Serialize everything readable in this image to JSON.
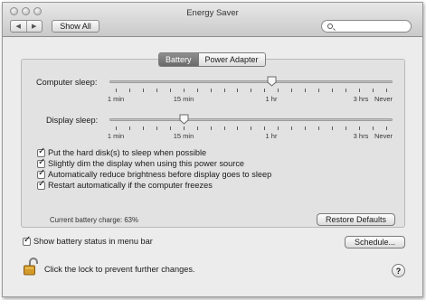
{
  "window": {
    "title": "Energy Saver"
  },
  "toolbar": {
    "back_glyph": "◀",
    "forward_glyph": "▶",
    "show_all_label": "Show All",
    "search_placeholder": ""
  },
  "tabs": [
    {
      "label": "Battery",
      "selected": true
    },
    {
      "label": "Power Adapter",
      "selected": false
    }
  ],
  "computer_sleep": {
    "label": "Computer sleep:",
    "selected": "1 hr",
    "tick_labels": [
      "1 min",
      "15 min",
      "1 hr",
      "3 hrs",
      "Never"
    ]
  },
  "display_sleep": {
    "label": "Display sleep:",
    "selected": "15 min",
    "tick_labels": [
      "1 min",
      "15 min",
      "1 hr",
      "3 hrs",
      "Never"
    ]
  },
  "options": [
    {
      "label": "Put the hard disk(s) to sleep when possible",
      "checked": true
    },
    {
      "label": "Slightly dim the display when using this power source",
      "checked": true
    },
    {
      "label": "Automatically reduce brightness before display goes to sleep",
      "checked": true
    },
    {
      "label": "Restart automatically if the computer freezes",
      "checked": true
    }
  ],
  "battery_charge": "Current battery charge: 63%",
  "restore_defaults_label": "Restore Defaults",
  "show_status": {
    "label": "Show battery status in menu bar",
    "checked": true
  },
  "schedule_label": "Schedule...",
  "lock_text": "Click the lock to prevent further changes.",
  "help_glyph": "?"
}
